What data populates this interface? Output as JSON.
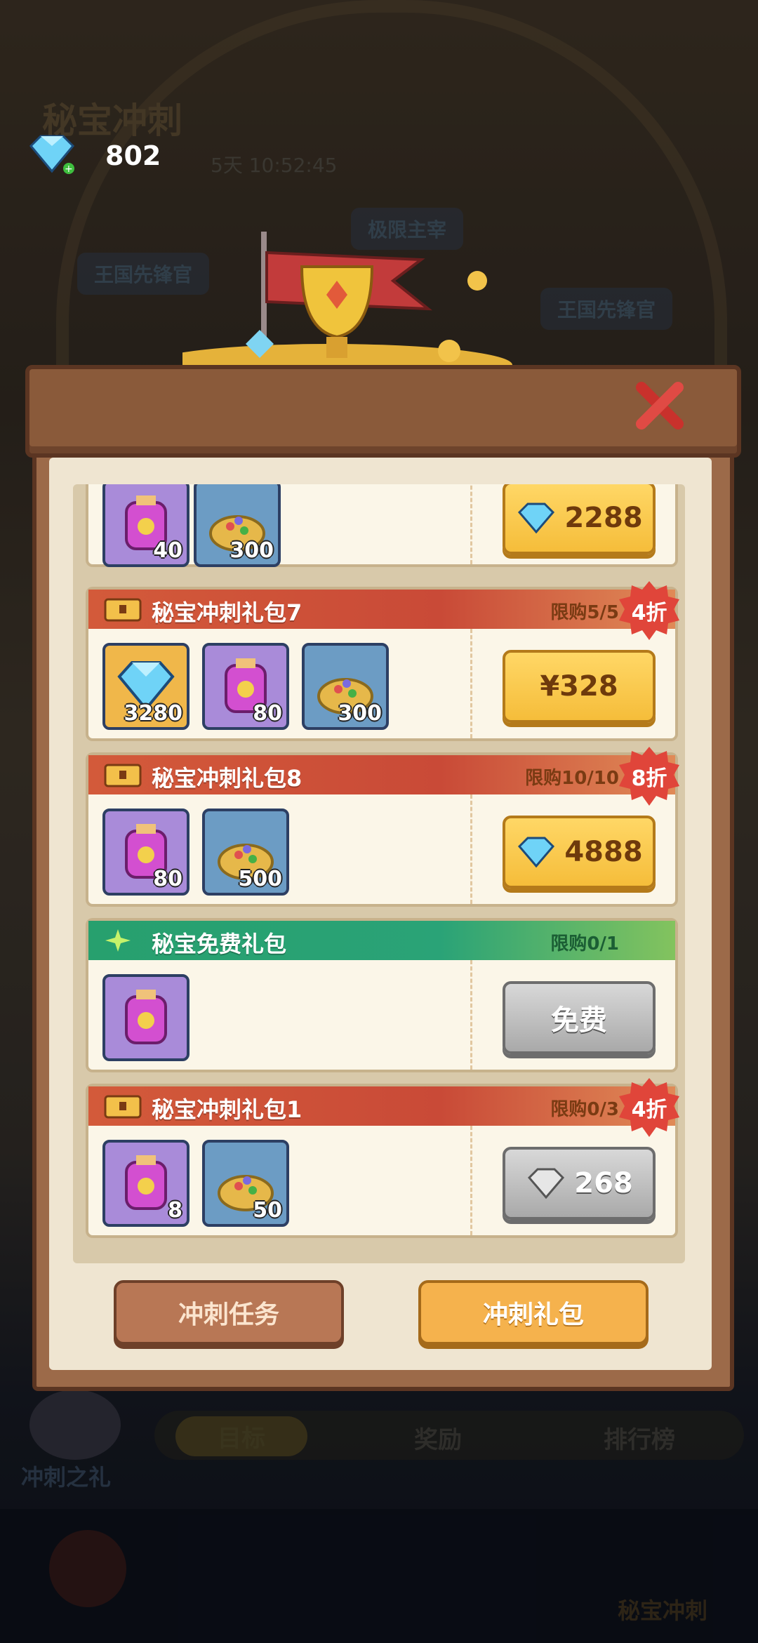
{
  "header": {
    "title": "秘宝冲刺",
    "timer": "5天 10:52:45",
    "gem_count": "802",
    "badges": [
      "王国先锋官",
      "极限主宰",
      "王国先锋官"
    ]
  },
  "colors": {
    "red_header": "#d35a3a",
    "green_header": "#27a06e",
    "gold_button": "#f5bd3a",
    "grey_button": "#a9a9a9",
    "discount_badge": "#e0453a"
  },
  "packs": [
    {
      "title": "",
      "limit": "",
      "items": [
        {
          "type": "potion",
          "count": "40"
        },
        {
          "type": "ore",
          "count": "300"
        }
      ],
      "price": "2288",
      "price_icon": "gem-icon"
    },
    {
      "title": "秘宝冲刺礼包7",
      "limit": "限购5/5",
      "discount": "4折",
      "items": [
        {
          "type": "gem",
          "count": "3280"
        },
        {
          "type": "potion",
          "count": "80"
        },
        {
          "type": "ore",
          "count": "300"
        }
      ],
      "price": "¥328"
    },
    {
      "title": "秘宝冲刺礼包8",
      "limit": "限购10/10",
      "discount": "8折",
      "items": [
        {
          "type": "potion",
          "count": "80"
        },
        {
          "type": "ore",
          "count": "500"
        }
      ],
      "price": "4888",
      "price_icon": "gem-icon"
    },
    {
      "title": "秘宝免费礼包",
      "limit": "限购0/1",
      "items": [
        {
          "type": "potion",
          "count": ""
        }
      ],
      "price": "免费"
    },
    {
      "title": "秘宝冲刺礼包1",
      "limit": "限购0/3",
      "discount": "4折",
      "items": [
        {
          "type": "potion",
          "count": "8"
        },
        {
          "type": "ore",
          "count": "50"
        }
      ],
      "price": "268",
      "price_icon": "gem-icon"
    }
  ],
  "footer_buttons": {
    "tasks": "冲刺任务",
    "gifts": "冲刺礼包"
  },
  "bottom_tabs": [
    "目标",
    "奖励",
    "排行榜"
  ],
  "sprint_gift_label": "冲刺之礼",
  "nav_label": "秘宝冲刺"
}
